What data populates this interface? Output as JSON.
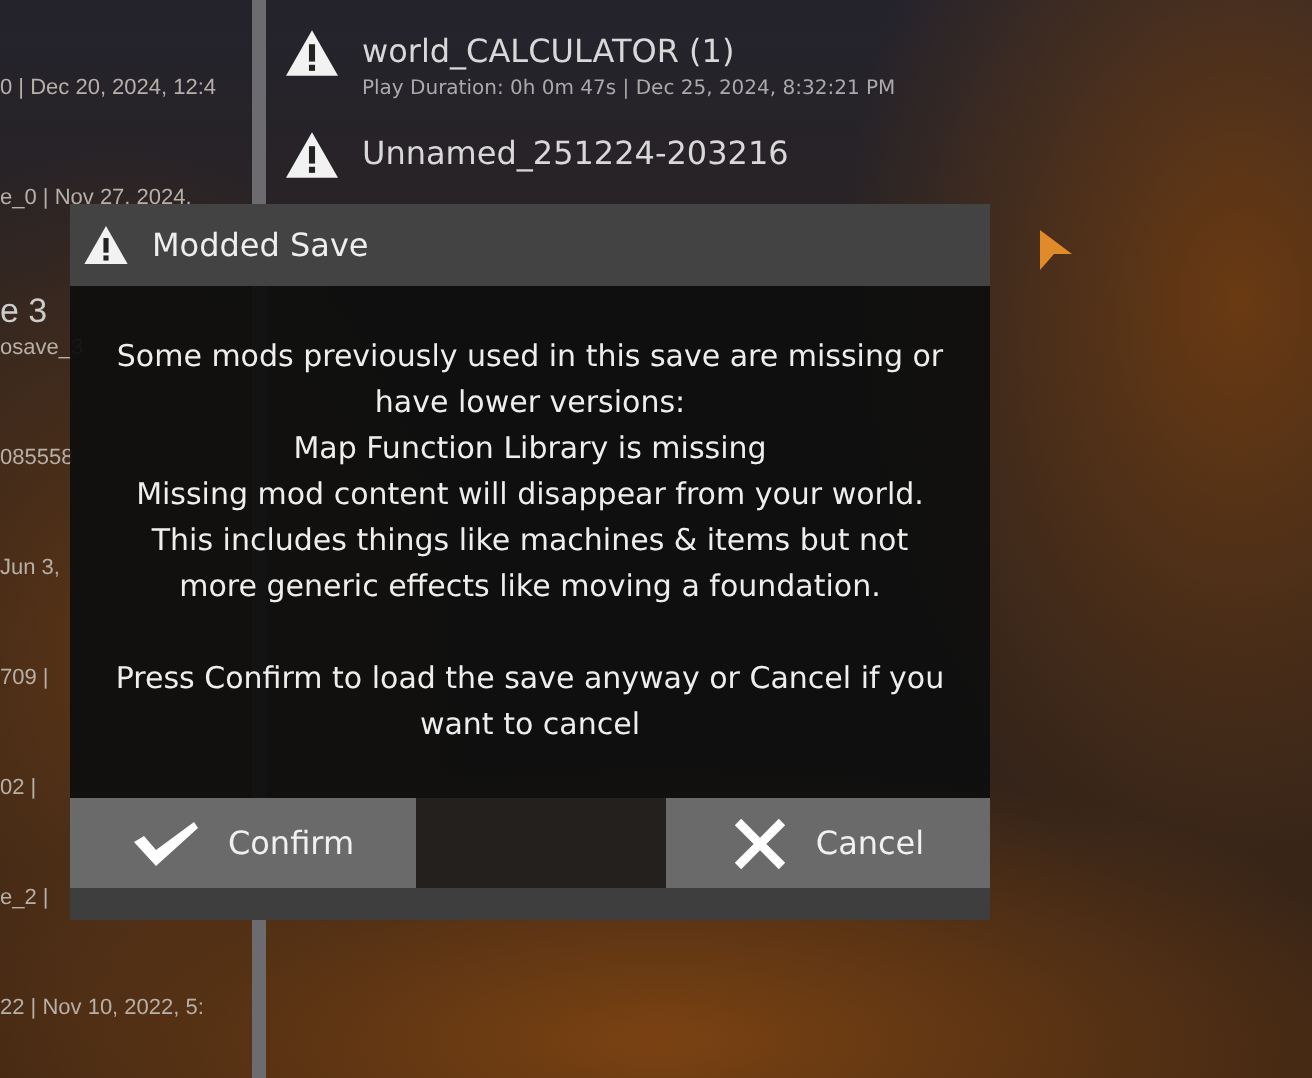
{
  "background": {
    "left_list": [
      {
        "kind": "meta",
        "text": "0 | Dec 20, 2024, 12:4"
      },
      {
        "kind": "meta",
        "text": "e_0 | Nov 27, 2024,"
      },
      {
        "kind": "title",
        "text": "e 3"
      },
      {
        "kind": "meta",
        "text": "osave_3"
      },
      {
        "kind": "meta",
        "text": "085558"
      },
      {
        "kind": "meta",
        "text": "Jun 3,"
      },
      {
        "kind": "meta",
        "text": "709 |"
      },
      {
        "kind": "meta",
        "text": "02 |"
      },
      {
        "kind": "meta",
        "text": "e_2 |"
      },
      {
        "kind": "meta",
        "text": "22 | Nov 10, 2022, 5:"
      }
    ],
    "saves": [
      {
        "name": "world_CALCULATOR (1)",
        "meta": "Play Duration: 0h 0m 47s | Dec 25, 2024, 8:32:21 PM"
      },
      {
        "name": "Unnamed_251224-203216"
      }
    ]
  },
  "dialog": {
    "title": "Modded Save",
    "paragraphs": [
      [
        "Some mods previously used in this save are missing or",
        "have lower versions:",
        "Map Function Library is missing",
        "Missing mod content will disappear from your world.",
        "This includes things like machines & items but not",
        "more generic effects like moving a foundation."
      ],
      [
        "Press Confirm to load the save anyway or Cancel if you",
        "want to cancel"
      ]
    ],
    "buttons": [
      {
        "kind": "confirm",
        "label": "Confirm"
      },
      {
        "kind": "cancel",
        "label": "Cancel"
      }
    ]
  }
}
